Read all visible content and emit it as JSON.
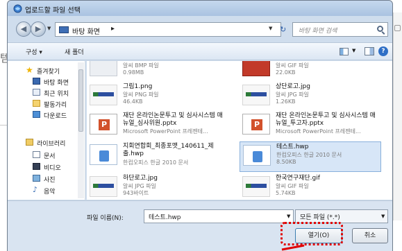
{
  "window": {
    "title": "업로드할 파일 선택"
  },
  "address": {
    "location": "바탕 화면",
    "separator": "▸",
    "search_placeholder": "바탕 화면 검색"
  },
  "toolbar": {
    "organize_label": "구성 ▾",
    "new_folder_label": "새 폴더"
  },
  "sidebar": {
    "favorites": "즐겨찾기",
    "favorites_items": [
      {
        "label": "바탕 화면",
        "icon": "desktop-icon"
      },
      {
        "label": "최근 위치",
        "icon": "recent-places-icon"
      },
      {
        "label": "팔동가리",
        "icon": "folder-icon"
      },
      {
        "label": "다운로드",
        "icon": "downloads-icon"
      }
    ],
    "libraries": "라이브러리",
    "library_items": [
      {
        "label": "문서",
        "icon": "documents-icon"
      },
      {
        "label": "비디오",
        "icon": "videos-icon"
      },
      {
        "label": "사진",
        "icon": "pictures-icon"
      },
      {
        "label": "음악",
        "icon": "music-icon"
      }
    ]
  },
  "files": [
    {
      "name": "",
      "type": "알씨 BMP 파일",
      "size": "0.98MB",
      "thumb": "bmp"
    },
    {
      "name": "",
      "type": "알씨 GIF 파일",
      "size": "22.0KB",
      "thumb": "redpic"
    },
    {
      "name": "그림1.png",
      "type": "알씨 PNG 파일",
      "size": "46.4KB",
      "thumb": "logo"
    },
    {
      "name": "상단로고.jpg",
      "type": "알씨 JPG 파일",
      "size": "1.26KB",
      "thumb": "logo"
    },
    {
      "name": "재단 온라인논문투고 및 심사시스템 매뉴얼_심사위원.pptx",
      "type": "Microsoft PowerPoint 프레젠테...",
      "size": "",
      "thumb": "ppt"
    },
    {
      "name": "재단 온라인논문투고 및 심사시스템 매뉴얼_투고자.pptx",
      "type": "Microsoft PowerPoint 프레젠테...",
      "size": "",
      "thumb": "ppt"
    },
    {
      "name": "지회연합회_최종포맷_140611_제출.hwp",
      "type": "한컴오피스 한글 2010 문서",
      "size": "",
      "thumb": "hwp"
    },
    {
      "name": "테스트.hwp",
      "type": "한컴오피스 한글 2010 문서",
      "size": "8.50KB",
      "thumb": "hwp",
      "selected": true
    },
    {
      "name": "하단로고.jpg",
      "type": "알씨 JPG 파일",
      "size": "943바이트",
      "thumb": "logo"
    },
    {
      "name": "한국연구재단.gif",
      "type": "알씨 GIF 파일",
      "size": "5.74KB",
      "thumb": "logo"
    }
  ],
  "bottom": {
    "filename_label": "파일 이름(N):",
    "filename_value": "테스트.hwp",
    "filetype_value": "모든 파일 (*.*)",
    "open_label": "열기(O)",
    "cancel_label": "취소"
  },
  "background": {
    "left_char": "템"
  },
  "colors": {
    "highlight_border": "#e00000",
    "selection_bg": "#d7e6f7"
  }
}
